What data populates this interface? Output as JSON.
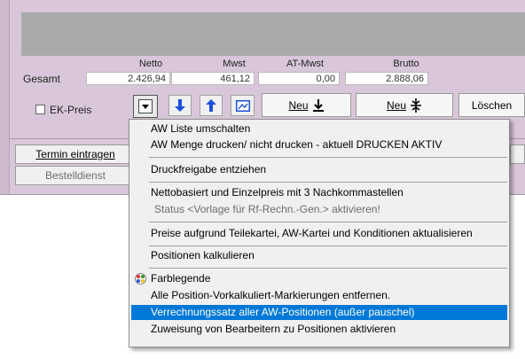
{
  "totals": {
    "columns": [
      "Netto",
      "Mwst",
      "AT-Mwst",
      "Brutto"
    ],
    "row_label": "Gesamt",
    "values": [
      "2.426,94",
      "461,12",
      "0,00",
      "2.888,06"
    ]
  },
  "toolbar": {
    "ek_preis_label": "EK-Preis",
    "neu_down_label": "Neu",
    "neu_split_label": "Neu",
    "loeschen_label": "Löschen"
  },
  "lower_buttons": {
    "termin_label": "Termin eintragen",
    "bestelldienst_label": "Bestelldienst"
  },
  "menu": {
    "items": [
      "AW Liste umschalten",
      "AW Menge drucken/ nicht drucken - aktuell DRUCKEN AKTIV",
      "Druckfreigabe entziehen",
      "Nettobasiert und Einzelpreis mit 3 Nachkommastellen",
      "Status <Vorlage für Rf-Rechn.-Gen.> aktivieren!",
      "Preise aufgrund Teilekartei, AW-Kartei und Konditionen aktualisieren",
      "Positionen kalkulieren",
      "Farblegende",
      "Alle Position-Vorkalkuliert-Markierungen entfernen.",
      "Verrechnungssatz aller AW-Positionen (außer pauschel)",
      "Zuweisung von Bearbeitern zu Positionen aktivieren"
    ]
  },
  "icons": {
    "arrow_down": "arrow-down-icon",
    "arrow_up": "arrow-up-icon",
    "image": "image-icon",
    "color_legend": "color-palette-icon"
  },
  "colors": {
    "accent_blue": "#0078d7",
    "panel_bg": "#d9c6da",
    "arrow_blue": "#1a4fd8"
  }
}
